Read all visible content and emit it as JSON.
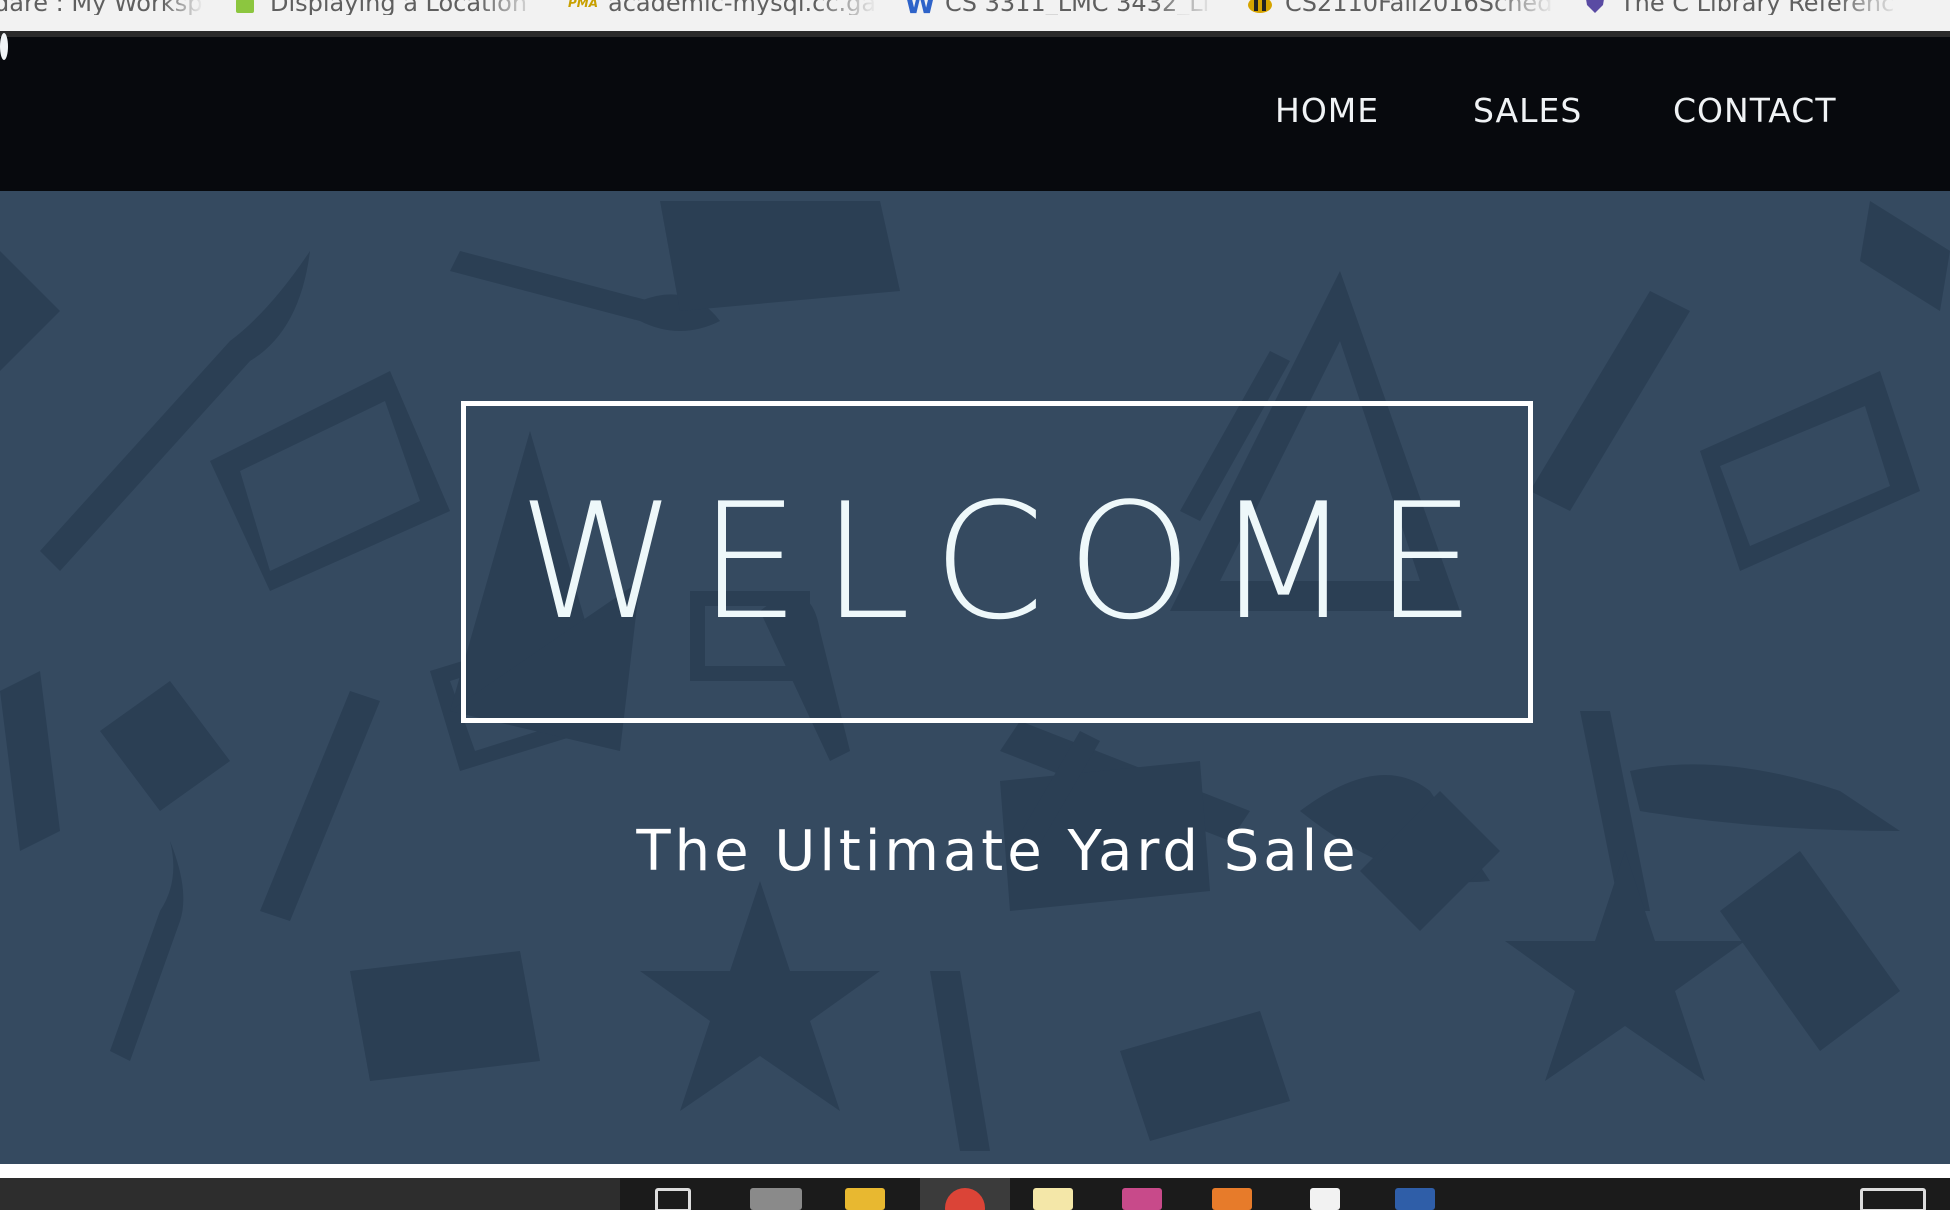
{
  "bookmarks": [
    {
      "label": "dare : My Worksp",
      "icon": "page-icon"
    },
    {
      "label": "Displaying a Location",
      "icon": "android-icon"
    },
    {
      "label": "academic-mysql.cc.ga",
      "icon": "phpmyadmin-icon"
    },
    {
      "label": "CS 3311_LMC 3432_Li",
      "icon": "word-icon"
    },
    {
      "label": "CS2110Fall2016Sched",
      "icon": "yellowjacket-icon"
    },
    {
      "label": "The C Library Referenc",
      "icon": "shield-icon"
    }
  ],
  "nav": {
    "home": "HOME",
    "sales": "SALES",
    "contact": "CONTACT"
  },
  "hero": {
    "title": "WELCOME",
    "tagline": "The Ultimate Yard Sale"
  },
  "colors": {
    "navbar": "#07090d",
    "hero_bg": "#354a60",
    "pattern": "#2b3f54",
    "text": "#eef8fa"
  }
}
